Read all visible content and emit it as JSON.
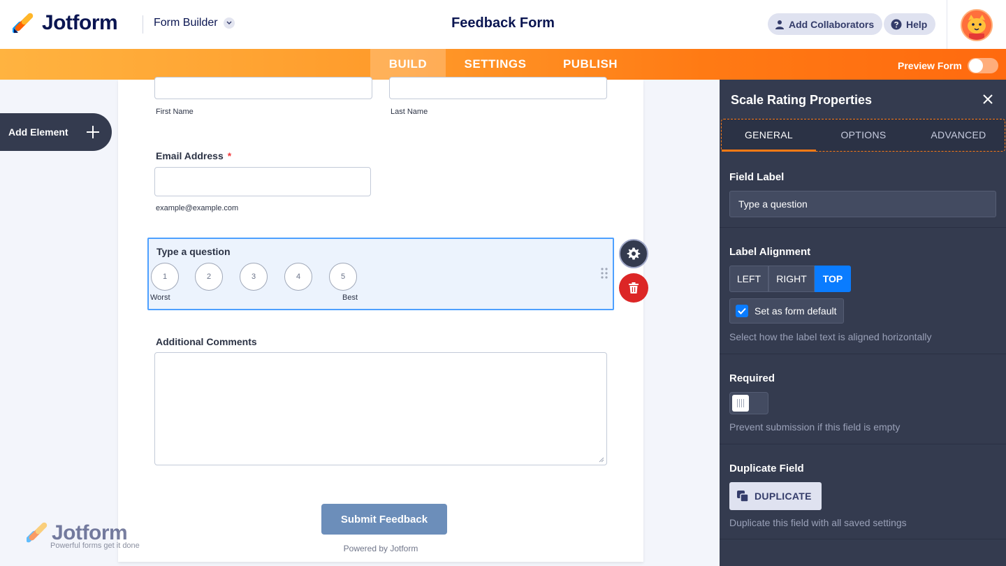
{
  "header": {
    "logo_text": "Jotform",
    "form_builder_label": "Form Builder",
    "form_title": "Feedback Form",
    "add_collaborators_label": "Add Collaborators",
    "help_label": "Help"
  },
  "nav": {
    "tabs": [
      {
        "label": "BUILD"
      },
      {
        "label": "SETTINGS"
      },
      {
        "label": "PUBLISH"
      }
    ],
    "preview_label": "Preview Form"
  },
  "sidebar": {
    "add_element_label": "Add Element"
  },
  "form": {
    "first_name_sublabel": "First Name",
    "last_name_sublabel": "Last Name",
    "email_label": "Email Address",
    "email_required_mark": "*",
    "email_sublabel": "example@example.com",
    "scale_question": "Type a question",
    "scale_options": [
      "1",
      "2",
      "3",
      "4",
      "5"
    ],
    "scale_low_label": "Worst",
    "scale_high_label": "Best",
    "comments_label": "Additional Comments",
    "submit_label": "Submit Feedback",
    "powered_by": "Powered by Jotform"
  },
  "watermark": {
    "text": "Jotform",
    "tagline": "Powerful forms get it done"
  },
  "panel": {
    "title": "Scale Rating Properties",
    "tabs": [
      {
        "label": "GENERAL"
      },
      {
        "label": "OPTIONS"
      },
      {
        "label": "ADVANCED"
      }
    ],
    "field_label_title": "Field Label",
    "field_label_value": "Type a question",
    "label_alignment_title": "Label Alignment",
    "alignment_options": [
      "LEFT",
      "RIGHT",
      "TOP"
    ],
    "alignment_selected": "TOP",
    "set_default_label": "Set as form default",
    "alignment_help": "Select how the label text is aligned horizontally",
    "required_title": "Required",
    "required_help": "Prevent submission if this field is empty",
    "duplicate_title": "Duplicate Field",
    "duplicate_button": "DUPLICATE",
    "duplicate_help": "Duplicate this field with all saved settings"
  },
  "colors": {
    "accent_orange": "#ff7a14",
    "panel_bg": "#343b4f",
    "selected_blue": "#0a7cff",
    "delete_red": "#dc2626",
    "submit_blue": "#6c8eba"
  }
}
